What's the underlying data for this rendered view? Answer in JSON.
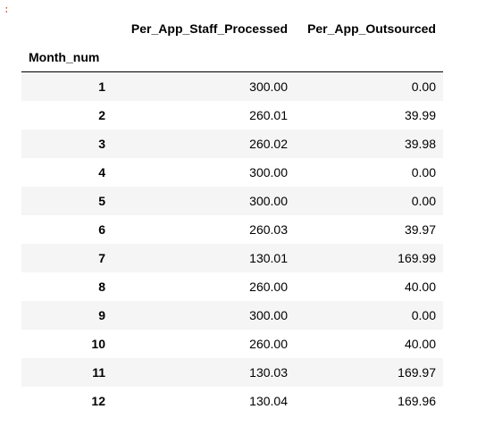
{
  "cell_marker": ":",
  "table": {
    "index_name": "Month_num",
    "columns": [
      "Per_App_Staff_Processed",
      "Per_App_Outsourced"
    ],
    "rows": [
      {
        "index": "1",
        "values": [
          "300.00",
          "0.00"
        ]
      },
      {
        "index": "2",
        "values": [
          "260.01",
          "39.99"
        ]
      },
      {
        "index": "3",
        "values": [
          "260.02",
          "39.98"
        ]
      },
      {
        "index": "4",
        "values": [
          "300.00",
          "0.00"
        ]
      },
      {
        "index": "5",
        "values": [
          "300.00",
          "0.00"
        ]
      },
      {
        "index": "6",
        "values": [
          "260.03",
          "39.97"
        ]
      },
      {
        "index": "7",
        "values": [
          "130.01",
          "169.99"
        ]
      },
      {
        "index": "8",
        "values": [
          "260.00",
          "40.00"
        ]
      },
      {
        "index": "9",
        "values": [
          "300.00",
          "0.00"
        ]
      },
      {
        "index": "10",
        "values": [
          "260.00",
          "40.00"
        ]
      },
      {
        "index": "11",
        "values": [
          "130.03",
          "169.97"
        ]
      },
      {
        "index": "12",
        "values": [
          "130.04",
          "169.96"
        ]
      }
    ]
  }
}
